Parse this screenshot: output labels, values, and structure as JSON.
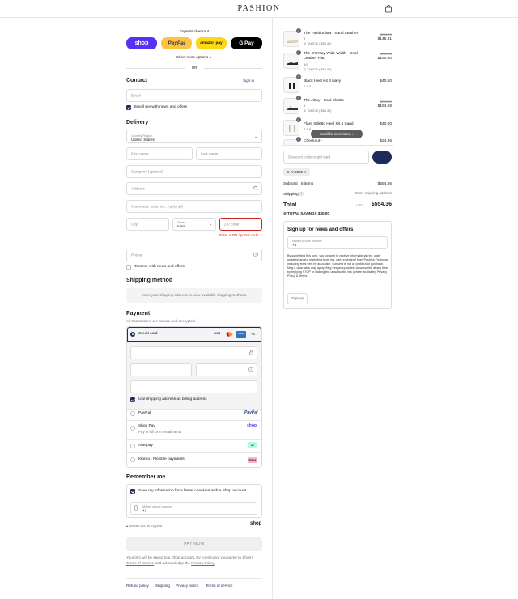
{
  "brand": "PASHION",
  "express": {
    "label": "Express checkout",
    "buttons": [
      "shop",
      "PayPal",
      "amazon pay",
      "G Pay"
    ],
    "more": "Show more options",
    "or": "OR"
  },
  "contact": {
    "title": "Contact",
    "signin": "Sign in",
    "email_placeholder": "Email",
    "email_news": "Email me with news and offers"
  },
  "delivery": {
    "title": "Delivery",
    "country_label": "Country/Region",
    "country_value": "United States",
    "first_name": "First name",
    "last_name": "Last name",
    "company": "Company (optional)",
    "address": "Address",
    "apartment": "Apartment, suite, etc. (optional)",
    "city": "City",
    "state_label": "State",
    "state_value": "Iowa",
    "zip": "ZIP code",
    "zip_error": "Enter a ZIP / postal code",
    "phone": "Phone",
    "text_news": "Text me with news and offers"
  },
  "shipping": {
    "title": "Shipping method",
    "message": "Enter your shipping address to view available shipping methods."
  },
  "payment": {
    "title": "Payment",
    "subtitle": "All transactions are secure and encrypted.",
    "credit_card": "Credit card",
    "more_cards": "+3",
    "billing_same": "Use shipping address as billing address",
    "paypal": "PayPal",
    "shop_pay": "Shop Pay",
    "shop_pay_sub": "Pay in full or in installments",
    "afterpay": "Afterpay",
    "klarna": "Klarna - Flexible payments",
    "klarna_badge": "Klarna"
  },
  "remember": {
    "title": "Remember me",
    "save_info": "Save my information for a faster checkout with a Shop account",
    "mobile_label": "Mobile phone number",
    "mobile_value": "+1",
    "secure": "Secure and encrypted",
    "shop_logo": "shop"
  },
  "pay_now": "PAY NOW",
  "disclaimer": {
    "text": "Your info will be saved to a Shop account. By continuing, you agree to Shop's",
    "tos": "Terms of Service",
    "and": "and acknowledge the",
    "privacy": "Privacy Policy."
  },
  "footer_links": [
    "Refund policy",
    "Shipping",
    "Privacy policy",
    "Terms of service"
  ],
  "order": {
    "items": [
      {
        "qty": "1",
        "name": "The Fashionista - Sand Leather",
        "variant": "5",
        "discount": "TAKE30 (-$62.40)",
        "orig": "$208.00",
        "price": "$145.31"
      },
      {
        "qty": "1",
        "name": "The D'Orsay Wide Width - Coal Leather Flat",
        "variant": "5/9",
        "discount": "TAKE30 (-$60.00)",
        "orig": "$210.00",
        "price": "$150.00"
      },
      {
        "qty": "1",
        "name": "Black Heel Kit 4 Navy",
        "variant": "1-4.5",
        "discount": "",
        "orig": "",
        "price": "$40.00"
      },
      {
        "qty": "1",
        "name": "The Abby - Coal Elastic",
        "variant": "5",
        "discount": "TAKE30 (-$66.30)",
        "orig": "$221.00",
        "price": "$154.69"
      },
      {
        "qty": "1",
        "name": "Flare Stiletto Heel Kit 4 Sand",
        "variant": "5-8.5",
        "discount": "",
        "orig": "",
        "price": "$40.00"
      },
      {
        "qty": "1",
        "name": "Checkout+",
        "variant": "",
        "discount": "",
        "orig": "",
        "price": "$24.36"
      }
    ],
    "scroll_hint": "Scroll for more items",
    "discount_placeholder": "Discount code or gift card",
    "applied_code": "TAKE30",
    "subtotal_label": "Subtotal · 6 items",
    "subtotal": "$554.36",
    "shipping_label": "Shipping",
    "shipping_value": "Enter shipping address",
    "total_label": "Total",
    "currency": "USD",
    "total": "$554.36",
    "savings": "TOTAL SAVINGS $30.00"
  },
  "signup": {
    "title": "Sign up for news and offers",
    "mobile_label": "Mobile phone number",
    "mobile_value": "+1",
    "consent": "By submitting this form, you consent to receive informational (eg. order updates) and/or marketing texts (eg. cart reminders) from Pashion Footwear including texts sent by autodialer. Consent is not a condition of purchase. Msg & data rates may apply. Msg frequency varies. Unsubscribe at any time by replying STOP or clicking the unsubscribe link (where available).",
    "privacy": "Privacy Policy",
    "amp": "&",
    "terms": "Terms",
    "button": "Sign up"
  },
  "colors": {
    "accent": "#1f2a5c",
    "shop": "#5a31f4",
    "paypal": "#ffc439",
    "amazon": "#ffd814",
    "error": "#d12020"
  }
}
